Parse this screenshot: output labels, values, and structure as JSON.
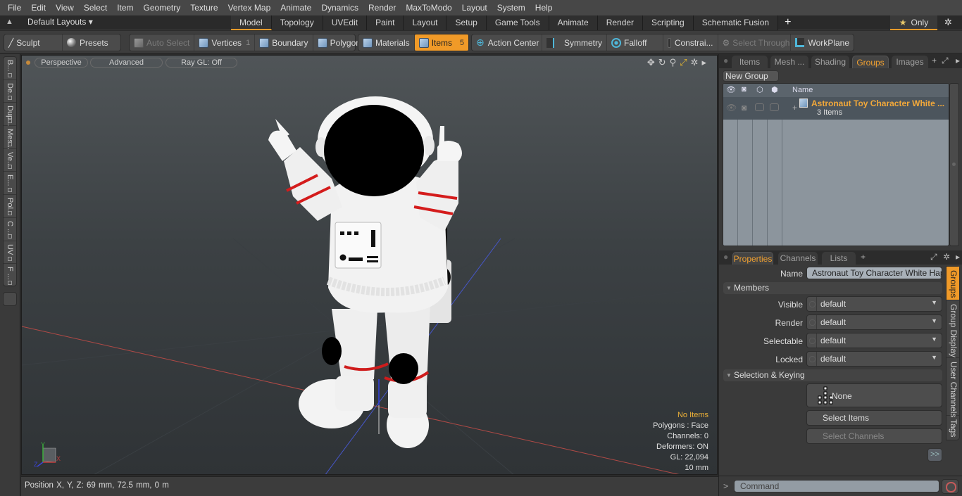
{
  "menu": [
    "File",
    "Edit",
    "View",
    "Select",
    "Item",
    "Geometry",
    "Texture",
    "Vertex Map",
    "Animate",
    "Dynamics",
    "Render",
    "MaxToModo",
    "Layout",
    "System",
    "Help"
  ],
  "layout_bar": {
    "layout_select": "Default Layouts ▾",
    "tabs": [
      "Model",
      "Topology",
      "UVEdit",
      "Paint",
      "Layout",
      "Setup",
      "Game Tools",
      "Animate",
      "Render",
      "Scripting",
      "Schematic Fusion"
    ],
    "active_tab": "Model",
    "add_tab": "+",
    "only_label": "Only",
    "star": "★",
    "gear": "✲"
  },
  "toolbar": {
    "sculpt": "Sculpt",
    "presets": "Presets",
    "auto_select": "Auto Select",
    "vertices": "Vertices",
    "vertices_count": "1",
    "boundary": "Boundary",
    "polygons": "Polygons",
    "materials": "Materials",
    "items": "Items",
    "items_count": "5",
    "action_center": "Action Center",
    "symmetry": "Symmetry",
    "falloff": "Falloff",
    "constraints": "Constrai...",
    "select_through": "Select Through",
    "workplane": "WorkPlane"
  },
  "left_tabs": [
    "B...",
    "De...",
    "Dup...",
    "Mes...",
    "Ve...",
    "E...",
    "Pol...",
    "C ...",
    "UV",
    "F ..."
  ],
  "viewport": {
    "view_mode": "Perspective",
    "shading": "Advanced",
    "raygl": "Ray GL: Off",
    "tools": [
      "✥",
      "↻",
      "⚲",
      "⤢",
      "✲",
      "▸"
    ],
    "stats": {
      "selection": "No Items",
      "polygons": "Polygons : Face",
      "channels": "Channels: 0",
      "deformers": "Deformers: ON",
      "gl": "GL: 22,094",
      "scale": "10 mm"
    },
    "axis_labels": {
      "x": "X",
      "y": "Y",
      "z": "Z"
    },
    "colors": {
      "x_axis": "#c8453f",
      "y_axis": "#3fae3f",
      "z_axis": "#4455dd",
      "suit": "#f1f1f1",
      "stripe": "#d41c1c",
      "visor": "#000000"
    }
  },
  "status": {
    "position": "Position X, Y, Z:   69 mm, 72.5 mm, 0 m"
  },
  "right_panel": {
    "top_tabs": [
      "Items",
      "Mesh ...",
      "Shading",
      "Groups",
      "Images"
    ],
    "top_active": "Groups",
    "new_group": "New Group",
    "list_header": {
      "name": "Name"
    },
    "group": {
      "name": "Astronaut Toy Character White ...",
      "count": "3 Items"
    },
    "bottom_tabs": [
      "Properties",
      "Channels",
      "Lists"
    ],
    "bottom_active": "Properties",
    "properties": {
      "name_label": "Name",
      "name_value": "Astronaut Toy Character White Happy",
      "members_section": "Members",
      "fields": [
        {
          "label": "Visible",
          "value": "default"
        },
        {
          "label": "Render",
          "value": "default"
        },
        {
          "label": "Selectable",
          "value": "default"
        },
        {
          "label": "Locked",
          "value": "default"
        }
      ],
      "selection_section": "Selection & Keying",
      "none_button": "None",
      "select_items": "Select Items",
      "select_channels": "Select Channels",
      "more": ">>"
    },
    "side_tabs": [
      "Groups",
      "Group Display",
      "User Channels",
      "Tags"
    ],
    "side_active": "Groups",
    "command_prompt": ">",
    "command_placeholder": "Command"
  }
}
